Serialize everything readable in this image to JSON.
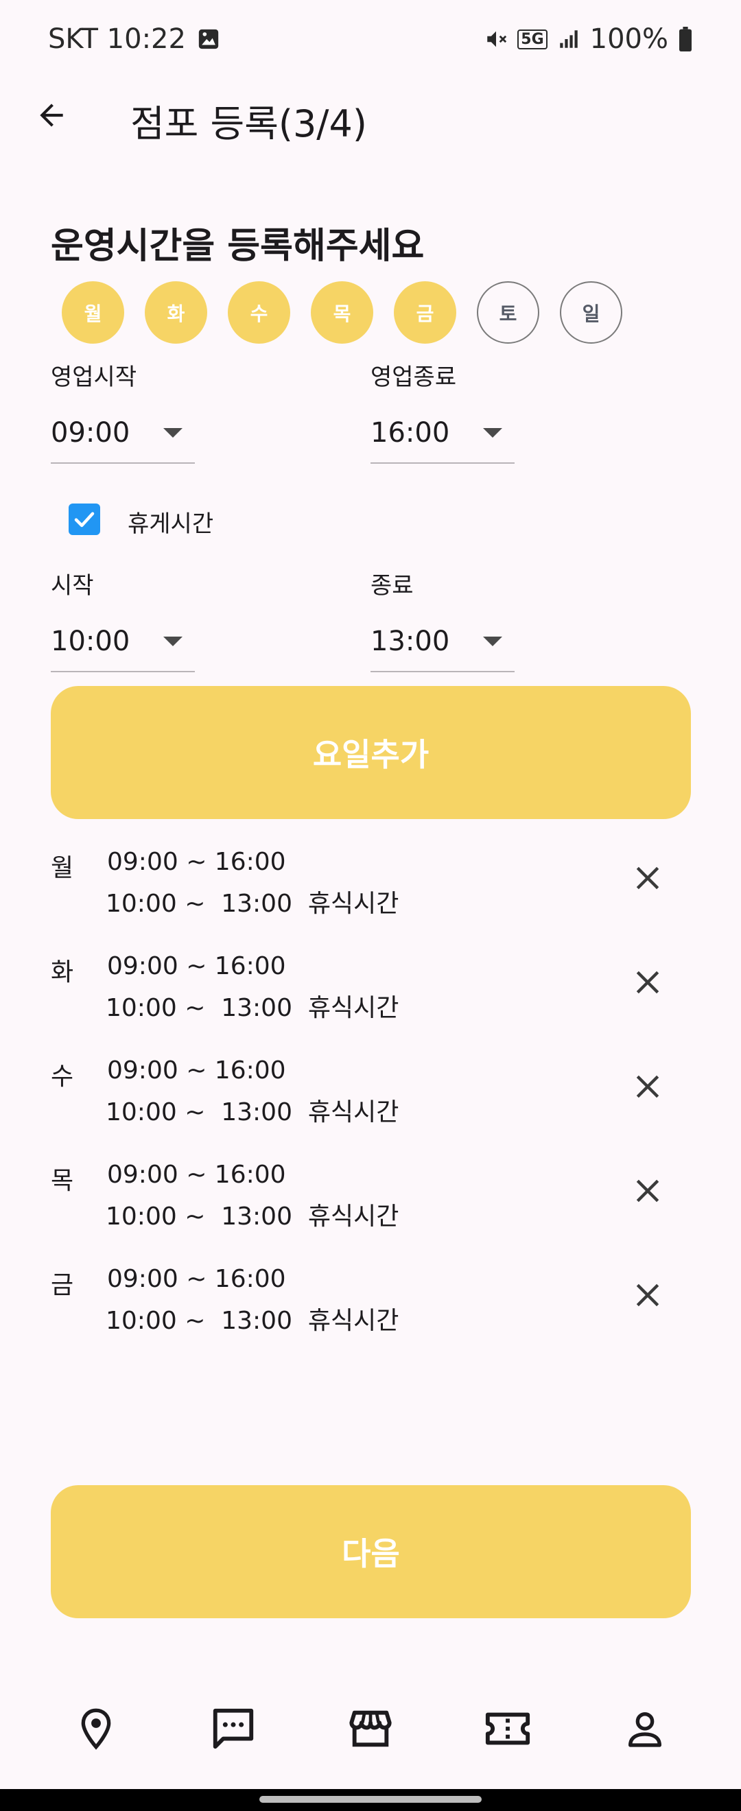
{
  "status_bar": {
    "carrier_time": "SKT 10:22",
    "network": "5G",
    "battery": "100%"
  },
  "app_bar": {
    "title": "점포 등록(3/4)"
  },
  "heading": "운영시간을 등록해주세요",
  "days": [
    {
      "label": "월",
      "selected": true
    },
    {
      "label": "화",
      "selected": true
    },
    {
      "label": "수",
      "selected": true
    },
    {
      "label": "목",
      "selected": true
    },
    {
      "label": "금",
      "selected": true
    },
    {
      "label": "토",
      "selected": false
    },
    {
      "label": "일",
      "selected": false
    }
  ],
  "business_hours": {
    "start_label": "영업시작",
    "start_value": "09:00",
    "end_label": "영업종료",
    "end_value": "16:00"
  },
  "break_time": {
    "checkbox_label": "휴게시간",
    "checked": true,
    "start_label": "시작",
    "start_value": "10:00",
    "end_label": "종료",
    "end_value": "13:00"
  },
  "add_day_button": "요일추가",
  "schedule": [
    {
      "day": "월",
      "line1": "09:00 ~ 16:00",
      "line2": "10:00 ~  13:00  휴식시간"
    },
    {
      "day": "화",
      "line1": "09:00 ~ 16:00",
      "line2": "10:00 ~  13:00  휴식시간"
    },
    {
      "day": "수",
      "line1": "09:00 ~ 16:00",
      "line2": "10:00 ~  13:00  휴식시간"
    },
    {
      "day": "목",
      "line1": "09:00 ~ 16:00",
      "line2": "10:00 ~  13:00  휴식시간"
    },
    {
      "day": "금",
      "line1": "09:00 ~ 16:00",
      "line2": "10:00 ~  13:00  휴식시간"
    }
  ],
  "next_button": "다음",
  "bottom_nav": [
    {
      "icon": "location-pin-icon"
    },
    {
      "icon": "chat-icon"
    },
    {
      "icon": "store-icon"
    },
    {
      "icon": "ticket-icon"
    },
    {
      "icon": "person-icon"
    }
  ],
  "colors": {
    "accent": "#f6d465",
    "checkbox": "#2196f3",
    "background": "#fdf8fb"
  }
}
